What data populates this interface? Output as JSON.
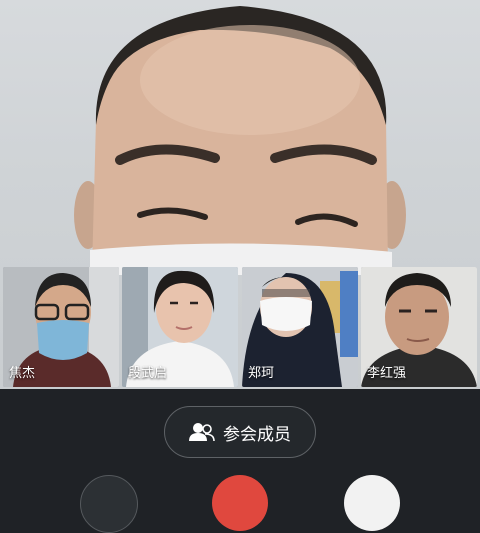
{
  "participants": [
    {
      "name": "焦杰"
    },
    {
      "name": "段武启"
    },
    {
      "name": "郑珂"
    },
    {
      "name": "李红强"
    }
  ],
  "toolbar": {
    "members_label": "参会成员",
    "members_icon": "people-icon"
  },
  "colors": {
    "background": "#1f2226",
    "end_call": "#e0483e",
    "text": "#ffffff"
  }
}
